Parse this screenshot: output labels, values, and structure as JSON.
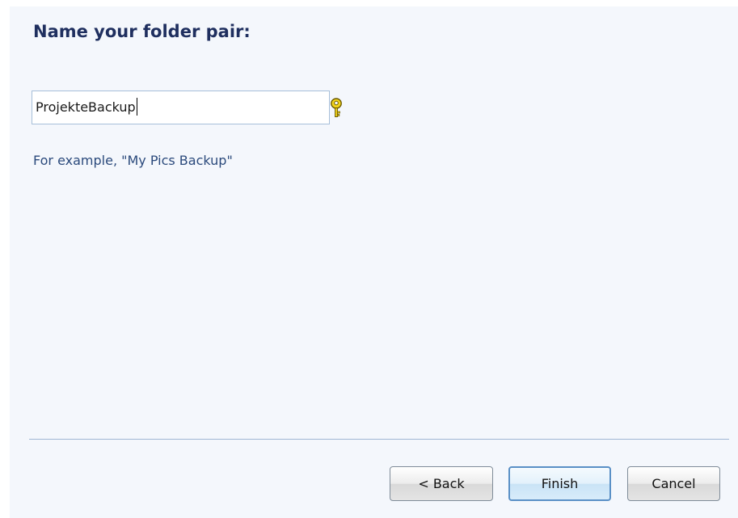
{
  "wizard": {
    "title": "Name your folder pair:",
    "folder_pair_name": "ProjekteBackup",
    "example_text": "For example, \"My Pics Backup\""
  },
  "buttons": {
    "back_label": "< Back",
    "finish_label": "Finish",
    "cancel_label": "Cancel"
  },
  "icons": {
    "help": "help-key-icon"
  },
  "colors": {
    "title": "#1f2f5f",
    "example_text": "#2b4a7c",
    "background": "#f4f7fc",
    "default_button_border": "#5a90c6"
  }
}
